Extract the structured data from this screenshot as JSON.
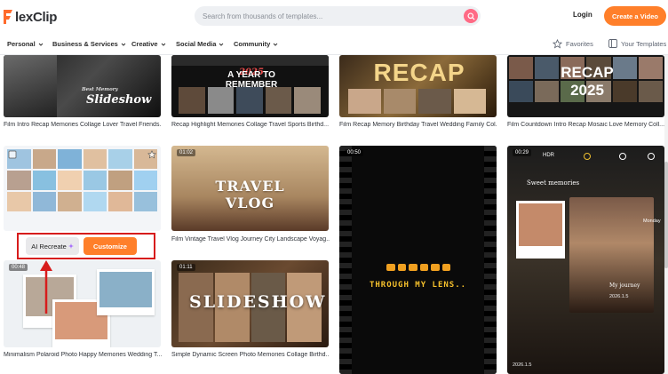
{
  "header": {
    "logo_text": "lexClip",
    "search_placeholder": "Search from thousands of templates...",
    "login_label": "Login",
    "create_label": "Create a Video"
  },
  "nav": {
    "items": [
      "Personal",
      "Business & Services",
      "Creative",
      "Social Media",
      "Community"
    ],
    "favorites": "Favorites",
    "your_templates": "Your Templates"
  },
  "cards": [
    {
      "caption": "Film Intro Recap Memories Collage Lover Travel Friends...",
      "overlay_title": "Best Memory",
      "overlay_main": "Slideshow"
    },
    {
      "caption": "Recap Highlight Memories Collage Travel Sports Birthd...",
      "overlay_main": "A YEAR TO REMEMBER"
    },
    {
      "caption": "Film Recap Memory Birthday Travel Wedding Family Col...",
      "overlay_main": "RECAP"
    },
    {
      "caption": "Film Countdown Intro Recap Mosaic Love Memory Coll...",
      "overlay_main": "RECAP 2025"
    },
    {
      "caption": "",
      "ai_label": "AI Recreate",
      "customize_label": "Customize"
    },
    {
      "caption": "Film Vintage Travel Vlog Journey City Landscape Voyag...",
      "time": "01:02",
      "overlay_main": "TRAVEL VLOG"
    },
    {
      "caption": "",
      "time": "00:50",
      "overlay_main": "THROUGH MY LENS.."
    },
    {
      "caption": "",
      "time": "00:29",
      "hdr": "HDR",
      "note1": "Sweet memories",
      "note2": "My journey",
      "date1": "2026.1.5",
      "date2": "2026.1.5",
      "side": "Monday"
    },
    {
      "caption": "Minimalism Polaroid Photo Happy Memories Wedding T...",
      "time": "00:48"
    },
    {
      "caption": "Simple Dynamic Screen Photo Memories Collage Birthd...",
      "time": "01:11",
      "overlay_main": "SLIDESHOW"
    }
  ],
  "colors": {
    "accent": "#ff7f2a",
    "highlight": "#d71c1c",
    "search_button": "#ff6a85"
  }
}
